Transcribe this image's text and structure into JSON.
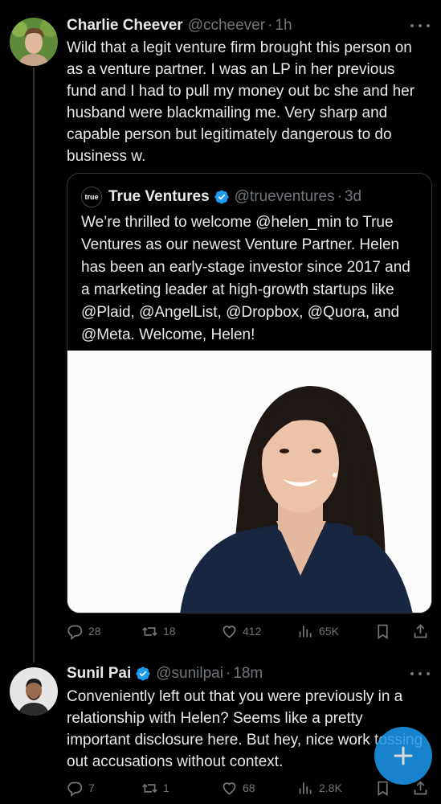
{
  "colors": {
    "background": "#000000",
    "text": "#e7e9ea",
    "muted": "#71767b",
    "accent": "#1d9bf0",
    "border": "#2f3336"
  },
  "tweets": [
    {
      "display_name": "Charlie Cheever",
      "handle": "@ccheever",
      "separator": "·",
      "time": "1h",
      "text": "Wild that a legit venture firm brought this person on as a venture partner. I was an LP in her previous fund and I had to pull my money out bc she and her husband were blackmailing me. Very sharp and capable person but legitimately dangerous to do business w.",
      "quote": {
        "logo_text": "true",
        "display_name": "True Ventures",
        "handle": "@trueventures",
        "separator": "·",
        "time": "3d",
        "text": "We’re thrilled to welcome @helen_min to True Ventures as our newest Venture Partner. Helen has been an early-stage investor since 2017 and a marketing leader at high-growth startups like @Plaid, @AngelList, @Dropbox, @Quora, and @Meta. Welcome, Helen!"
      },
      "actions": {
        "replies": "28",
        "reposts": "18",
        "likes": "412",
        "views": "65K"
      }
    },
    {
      "display_name": "Sunil Pai",
      "handle": "@sunilpai",
      "separator": "·",
      "time": "18m",
      "text": "Conveniently left out that you were previously in a relationship with Helen? Seems like a pretty important disclosure here. But hey, nice work tossing out accusations without context.",
      "actions": {
        "replies": "7",
        "reposts": "1",
        "likes": "68",
        "views": "2.8K"
      }
    }
  ],
  "icons": [
    "more-icon",
    "verified-icon",
    "reply-icon",
    "repost-icon",
    "like-icon",
    "views-icon",
    "bookmark-icon",
    "share-icon",
    "compose-icon"
  ]
}
